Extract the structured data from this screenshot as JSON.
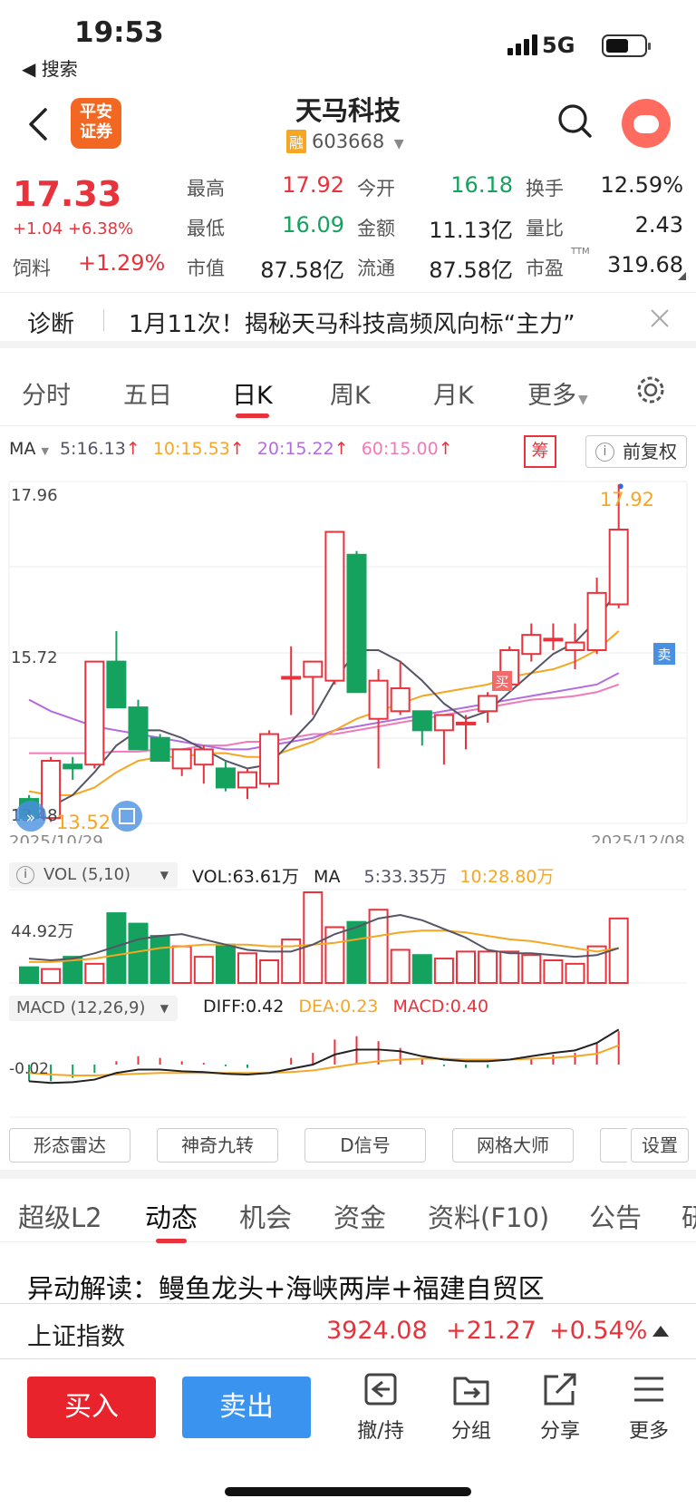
{
  "status_bar": {
    "time": "19:53",
    "back_app": "◀ 搜索",
    "network": "5G"
  },
  "header": {
    "logo_line1": "平安",
    "logo_line2": "证券",
    "stock_name": "天马科技",
    "margin_tag": "融",
    "stock_code": "603668"
  },
  "quote": {
    "price": "17.33",
    "change": "+1.04 +6.38%",
    "sector_label": "饲料",
    "sector_change": "+1.29%",
    "high_label": "最高",
    "high": "17.92",
    "open_label": "今开",
    "open": "16.18",
    "turnover_label": "换手",
    "turnover": "12.59%",
    "low_label": "最低",
    "low": "16.09",
    "amount_label": "金额",
    "amount": "11.13亿",
    "vol_ratio_label": "量比",
    "vol_ratio": "2.43",
    "mcap_label": "市值",
    "mcap": "87.58亿",
    "float_label": "流通",
    "float_cap": "87.58亿",
    "pe_label": "市盈",
    "pe_sup": "TTM",
    "pe": "319.68"
  },
  "diagnosis": {
    "label": "诊断",
    "text": "1月11次！揭秘天马科技高频风向标“主力”"
  },
  "period_tabs": [
    "分时",
    "五日",
    "日K",
    "周K",
    "月K",
    "更多"
  ],
  "active_period": "日K",
  "ma_legend": {
    "label": "MA",
    "ma5": "5:16.13",
    "ma10": "10:15.53",
    "ma20": "20:15.22",
    "ma60": "60:15.00",
    "chips_label": "筹",
    "adjust_label": "前复权"
  },
  "colors": {
    "up": "#e8323c",
    "down": "#14a25e",
    "ma5": "#555566",
    "ma10": "#f5a623",
    "ma20": "#b36be0",
    "ma60": "#f07ab8",
    "buy": "#e8232b",
    "sell": "#3b93f0"
  },
  "chart_data": [
    {
      "type": "candlestick",
      "title": "日K",
      "y_ticks": [
        "17.96",
        "15.72",
        "13.48"
      ],
      "ylim": [
        13.48,
        17.96
      ],
      "x_start_label": "2025/10/29",
      "x_end_label": "2025/12/08",
      "annotations": {
        "max": "17.92",
        "min": "13.52",
        "buy_marker": "买",
        "sell_marker": "卖"
      },
      "candles": [
        {
          "o": 13.8,
          "h": 13.85,
          "l": 13.52,
          "c": 13.55
        },
        {
          "o": 13.55,
          "h": 14.35,
          "l": 13.5,
          "c": 14.3
        },
        {
          "o": 14.25,
          "h": 14.35,
          "l": 14.05,
          "c": 14.2
        },
        {
          "o": 14.25,
          "h": 15.6,
          "l": 14.2,
          "c": 15.6
        },
        {
          "o": 15.6,
          "h": 16.0,
          "l": 15.0,
          "c": 15.0
        },
        {
          "o": 15.0,
          "h": 15.1,
          "l": 14.45,
          "c": 14.45
        },
        {
          "o": 14.6,
          "h": 14.65,
          "l": 14.3,
          "c": 14.3
        },
        {
          "o": 14.2,
          "h": 14.45,
          "l": 14.1,
          "c": 14.45
        },
        {
          "o": 14.25,
          "h": 14.5,
          "l": 14.0,
          "c": 14.45
        },
        {
          "o": 14.2,
          "h": 14.3,
          "l": 13.9,
          "c": 13.95
        },
        {
          "o": 13.95,
          "h": 14.2,
          "l": 13.8,
          "c": 14.15
        },
        {
          "o": 14.0,
          "h": 14.7,
          "l": 13.95,
          "c": 14.65
        },
        {
          "o": 15.4,
          "h": 15.8,
          "l": 14.9,
          "c": 15.4
        },
        {
          "o": 15.4,
          "h": 15.6,
          "l": 14.9,
          "c": 15.6
        },
        {
          "o": 15.35,
          "h": 17.3,
          "l": 15.3,
          "c": 17.3
        },
        {
          "o": 17.0,
          "h": 17.05,
          "l": 15.2,
          "c": 15.2
        },
        {
          "o": 14.85,
          "h": 15.5,
          "l": 14.2,
          "c": 15.35
        },
        {
          "o": 14.95,
          "h": 15.6,
          "l": 14.9,
          "c": 15.25
        },
        {
          "o": 14.95,
          "h": 14.95,
          "l": 14.5,
          "c": 14.7
        },
        {
          "o": 14.7,
          "h": 14.85,
          "l": 14.25,
          "c": 14.9
        },
        {
          "o": 14.8,
          "h": 14.9,
          "l": 14.45,
          "c": 14.8
        },
        {
          "o": 14.95,
          "h": 15.2,
          "l": 14.8,
          "c": 15.15
        },
        {
          "o": 15.3,
          "h": 15.8,
          "l": 15.25,
          "c": 15.75
        },
        {
          "o": 15.7,
          "h": 16.1,
          "l": 15.6,
          "c": 15.95
        },
        {
          "o": 15.9,
          "h": 16.1,
          "l": 15.75,
          "c": 15.9
        },
        {
          "o": 15.75,
          "h": 16.1,
          "l": 15.5,
          "c": 15.85
        },
        {
          "o": 15.75,
          "h": 16.7,
          "l": 15.7,
          "c": 16.5
        },
        {
          "o": 16.35,
          "h": 17.92,
          "l": 16.3,
          "c": 17.33
        }
      ],
      "ma_lines": {
        "ma5": [
          13.65,
          13.7,
          13.85,
          14.15,
          14.5,
          14.7,
          14.7,
          14.6,
          14.45,
          14.3,
          14.2,
          14.25,
          14.55,
          14.85,
          15.35,
          15.75,
          15.75,
          15.6,
          15.35,
          15.05,
          14.85,
          14.95,
          15.2,
          15.45,
          15.7,
          15.85,
          16.15,
          16.55
        ],
        "ma10": [
          13.9,
          13.85,
          13.85,
          13.95,
          14.15,
          14.3,
          14.35,
          14.35,
          14.4,
          14.4,
          14.35,
          14.35,
          14.45,
          14.55,
          14.7,
          14.85,
          14.95,
          15.05,
          15.15,
          15.2,
          15.25,
          15.3,
          15.4,
          15.45,
          15.5,
          15.6,
          15.75,
          16.0
        ],
        "ma20": [
          15.1,
          14.95,
          14.85,
          14.75,
          14.7,
          14.65,
          14.6,
          14.55,
          14.5,
          14.45,
          14.45,
          14.5,
          14.55,
          14.6,
          14.7,
          14.75,
          14.8,
          14.85,
          14.9,
          14.95,
          15.0,
          15.05,
          15.1,
          15.15,
          15.2,
          15.25,
          15.3,
          15.45
        ],
        "ma60": [
          14.4,
          14.4,
          14.4,
          14.4,
          14.42,
          14.42,
          14.45,
          14.45,
          14.5,
          14.5,
          14.55,
          14.55,
          14.6,
          14.65,
          14.65,
          14.7,
          14.75,
          14.8,
          14.85,
          14.9,
          14.95,
          15.0,
          15.05,
          15.1,
          15.12,
          15.15,
          15.2,
          15.3
        ]
      }
    },
    {
      "type": "bar",
      "title": "VOL",
      "legend": "VOL (5,10)",
      "vol_text": "VOL:63.61万",
      "ma_label": "MA",
      "ma5_text": "5:33.35万",
      "ma10_text": "10:28.80万",
      "y_tick": "44.92万",
      "values": [
        9,
        8,
        15,
        11,
        40,
        34,
        27,
        21,
        15,
        22,
        17,
        13,
        25,
        52,
        32,
        35,
        42,
        19,
        16,
        14,
        18,
        18,
        18,
        16,
        13,
        11,
        21,
        37
      ],
      "ma5": [
        14,
        13,
        14,
        17,
        21,
        25,
        27,
        28,
        25,
        22,
        19,
        18,
        18,
        22,
        28,
        32,
        37,
        39,
        36,
        31,
        26,
        19,
        17,
        17,
        16,
        15,
        16,
        20
      ],
      "ma10": [
        12,
        12,
        13,
        14,
        16,
        18,
        20,
        21,
        22,
        22,
        22,
        21,
        21,
        22,
        23,
        25,
        27,
        29,
        30,
        30,
        29,
        27,
        25,
        24,
        22,
        20,
        18,
        20
      ]
    },
    {
      "type": "line",
      "title": "MACD",
      "legend": "MACD (12,26,9)",
      "diff_text": "DIFF:0.42",
      "dea_text": "DEA:0.23",
      "macd_text": "MACD:0.40",
      "y_tick": "-0.02",
      "diff": [
        -0.2,
        -0.22,
        -0.21,
        -0.18,
        -0.1,
        -0.06,
        -0.06,
        -0.08,
        -0.09,
        -0.11,
        -0.12,
        -0.1,
        -0.05,
        0.0,
        0.12,
        0.18,
        0.18,
        0.16,
        0.1,
        0.06,
        0.04,
        0.04,
        0.06,
        0.1,
        0.14,
        0.17,
        0.26,
        0.42
      ],
      "dea": [
        -0.1,
        -0.12,
        -0.13,
        -0.13,
        -0.12,
        -0.11,
        -0.1,
        -0.1,
        -0.1,
        -0.1,
        -0.1,
        -0.1,
        -0.09,
        -0.07,
        -0.03,
        0.01,
        0.04,
        0.06,
        0.07,
        0.07,
        0.06,
        0.06,
        0.06,
        0.07,
        0.08,
        0.1,
        0.13,
        0.23
      ],
      "macd": [
        -0.2,
        -0.2,
        -0.16,
        -0.1,
        0.04,
        0.1,
        0.08,
        0.04,
        0.02,
        -0.02,
        -0.04,
        0.0,
        0.08,
        0.14,
        0.3,
        0.34,
        0.28,
        0.2,
        0.06,
        -0.02,
        -0.04,
        -0.04,
        0.0,
        0.06,
        0.12,
        0.14,
        0.26,
        0.4
      ]
    }
  ],
  "tools": [
    "形态雷达",
    "神奇九转",
    "D信号",
    "网格大师",
    "设置"
  ],
  "info_tabs": [
    "超级L2",
    "动态",
    "机会",
    "资金",
    "资料(F10)",
    "公告",
    "研"
  ],
  "active_info_tab": "动态",
  "news_headline": "异动解读：鳗鱼龙头+海峡两岸+福建自贸区",
  "index_bar": {
    "name": "上证指数",
    "value": "3924.08",
    "change": "+21.27",
    "pct": "+0.54%"
  },
  "bottom": {
    "buy": "买入",
    "sell": "卖出",
    "actions": [
      "撤/持",
      "分组",
      "分享",
      "更多"
    ]
  }
}
